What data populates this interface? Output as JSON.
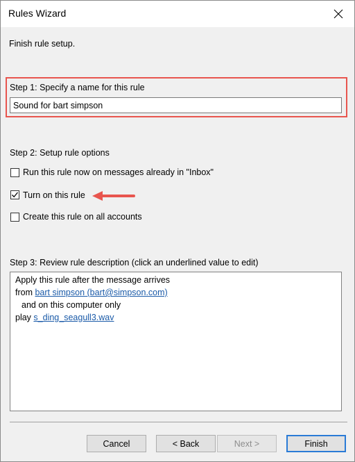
{
  "window": {
    "title": "Rules Wizard"
  },
  "intro": "Finish rule setup.",
  "step1": {
    "label": "Step 1: Specify a name for this rule",
    "rule_name": "Sound for bart simpson"
  },
  "step2": {
    "label": "Step 2: Setup rule options",
    "options": [
      {
        "label": "Run this rule now on messages already in \"Inbox\"",
        "checked": false
      },
      {
        "label": "Turn on this rule",
        "checked": true
      },
      {
        "label": "Create this rule on all accounts",
        "checked": false
      }
    ]
  },
  "step3": {
    "label": "Step 3: Review rule description (click an underlined value to edit)",
    "lines": {
      "line1": "Apply this rule after the message arrives",
      "from_prefix": "from",
      "from_link": "bart simpson (bart@simpson.com)",
      "line3": "and on this computer only",
      "play_prefix": "play",
      "play_link": "s_ding_seagull3.wav"
    }
  },
  "buttons": {
    "cancel": "Cancel",
    "back": "< Back",
    "next": "Next >",
    "finish": "Finish"
  },
  "colors": {
    "highlight_border": "#e8554e",
    "arrow": "#e8554e",
    "link": "#1a5aa8",
    "default_button_border": "#2a7bd6"
  },
  "icons": {
    "close": "close-icon",
    "checkmark": "checkmark-icon",
    "annotation_arrow": "arrow-left-icon"
  }
}
